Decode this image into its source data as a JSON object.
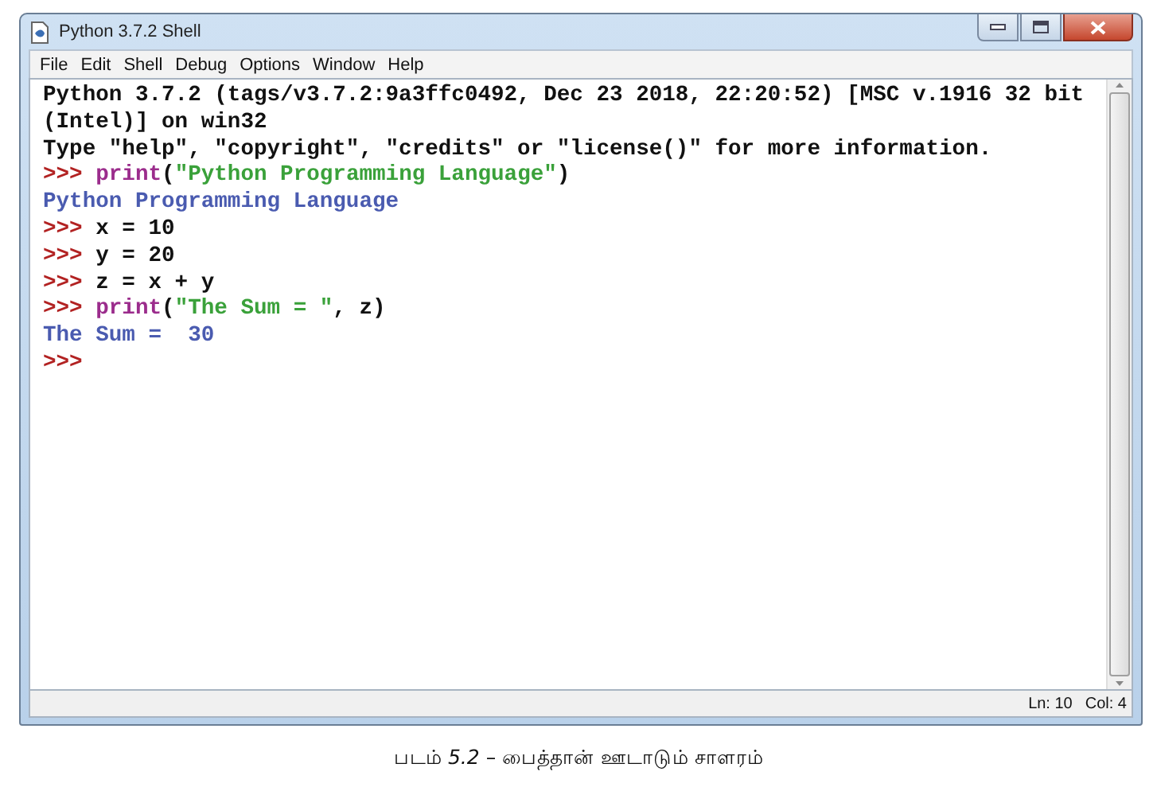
{
  "window": {
    "title": "Python 3.7.2 Shell"
  },
  "menu": [
    "File",
    "Edit",
    "Shell",
    "Debug",
    "Options",
    "Window",
    "Help"
  ],
  "shell_lines": [
    [
      {
        "kind": "plain",
        "text": "Python 3.7.2 (tags/v3.7.2:9a3ffc0492, Dec 23 2018, 22:20:52) [MSC v.1916 32 bit"
      }
    ],
    [
      {
        "kind": "plain",
        "text": "(Intel)] on win32"
      }
    ],
    [
      {
        "kind": "plain",
        "text": "Type \"help\", \"copyright\", \"credits\" or \"license()\" for more information."
      }
    ],
    [
      {
        "kind": "prompt",
        "text": ">>> "
      },
      {
        "kind": "builtin",
        "text": "print"
      },
      {
        "kind": "plain",
        "text": "("
      },
      {
        "kind": "string",
        "text": "\"Python Programming Language\""
      },
      {
        "kind": "plain",
        "text": ")"
      }
    ],
    [
      {
        "kind": "output",
        "text": "Python Programming Language"
      }
    ],
    [
      {
        "kind": "prompt",
        "text": ">>> "
      },
      {
        "kind": "plain",
        "text": "x = 10"
      }
    ],
    [
      {
        "kind": "prompt",
        "text": ">>> "
      },
      {
        "kind": "plain",
        "text": "y = 20"
      }
    ],
    [
      {
        "kind": "prompt",
        "text": ">>> "
      },
      {
        "kind": "plain",
        "text": "z = x + y"
      }
    ],
    [
      {
        "kind": "prompt",
        "text": ">>> "
      },
      {
        "kind": "builtin",
        "text": "print"
      },
      {
        "kind": "plain",
        "text": "("
      },
      {
        "kind": "string",
        "text": "\"The Sum = \""
      },
      {
        "kind": "plain",
        "text": ", z)"
      }
    ],
    [
      {
        "kind": "output",
        "text": "The Sum =  30"
      }
    ],
    [
      {
        "kind": "prompt",
        "text": ">>>"
      }
    ]
  ],
  "status_bar": {
    "line": "Ln: 10",
    "column": "Col: 4"
  },
  "caption": "படம் *5.2* – பைத்தான் ஊடாடும் சாளரம்"
}
